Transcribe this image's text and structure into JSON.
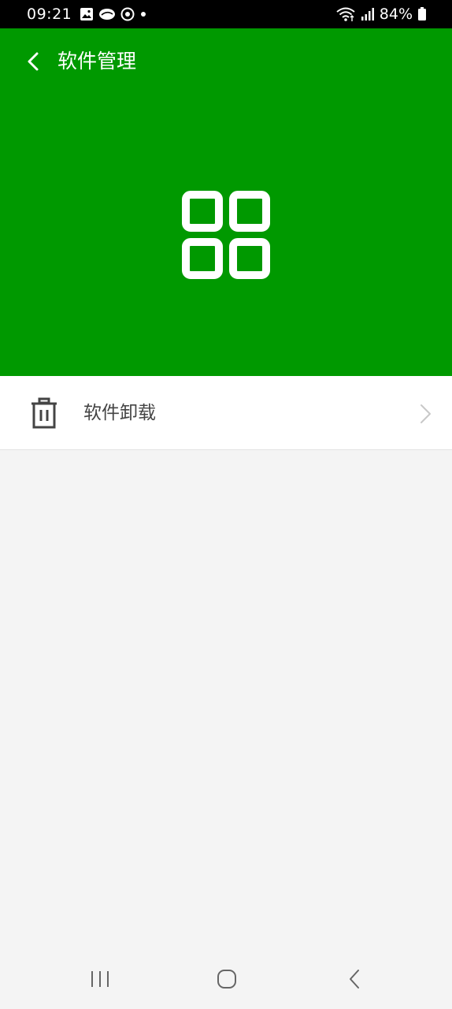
{
  "status_bar": {
    "time": "09:21",
    "battery": "84%",
    "icons_left": [
      "gallery-icon",
      "cloud-icon",
      "sync-icon",
      "dot-icon"
    ],
    "icons_right": [
      "wifi-icon",
      "signal-icon",
      "battery-icon"
    ]
  },
  "header": {
    "title": "软件管理",
    "back_icon": "chevron-left-icon",
    "hero_icon": "apps-grid-icon",
    "background_color": "#009900"
  },
  "menu": {
    "items": [
      {
        "label": "软件卸载",
        "icon": "trash-icon",
        "chevron": "chevron-right-icon"
      }
    ]
  },
  "nav_bar": {
    "buttons": [
      "recent-apps",
      "home",
      "back"
    ]
  }
}
